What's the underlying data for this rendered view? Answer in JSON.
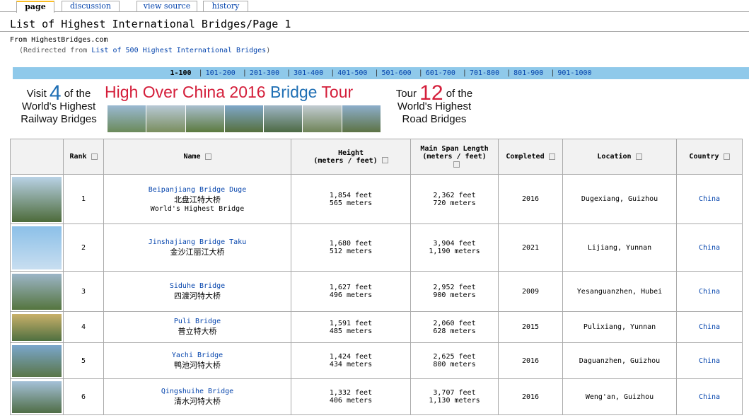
{
  "tabs": [
    {
      "label": "page",
      "active": true
    },
    {
      "label": "discussion",
      "active": false
    },
    {
      "label": "view source",
      "active": false
    },
    {
      "label": "history",
      "active": false
    }
  ],
  "title": "List of Highest International Bridges/Page 1",
  "from": "From HighestBridges.com",
  "redirect": {
    "prefix": "(Redirected from ",
    "link": "List of 500 Highest International Bridges",
    "suffix": ")"
  },
  "pager": [
    "1-100",
    "101-200",
    "201-300",
    "301-400",
    "401-500",
    "501-600",
    "601-700",
    "701-800",
    "801-900",
    "901-1000"
  ],
  "banner": {
    "left_visit": "Visit",
    "left_num": "4",
    "left_of": "of the",
    "left_line2": "World's Highest",
    "left_line3": "Railway Bridges",
    "mid_title_red": "High Over China 2016 ",
    "mid_title_blue": "Bridge",
    "mid_title_red2": " Tour",
    "right_tour": "Tour",
    "right_num": "12",
    "right_of": "of the",
    "right_line2": "World's Highest",
    "right_line3": "Road Bridges"
  },
  "table": {
    "headers": {
      "rank": "Rank",
      "name": "Name",
      "height1": "Height",
      "height2": "(meters / feet)",
      "span1": "Main Span Length",
      "span2": "(meters / feet)",
      "completed": "Completed",
      "location": "Location",
      "country": "Country"
    },
    "rows": [
      {
        "rank": "1",
        "name": "Beipanjiang Bridge Duge",
        "cn": "北盘江特大桥",
        "extra": "World's Highest Bridge",
        "h_ft": "1,854 feet",
        "h_m": "565 meters",
        "s_ft": "2,362 feet",
        "s_m": "720 meters",
        "completed": "2016",
        "location": "Dugexiang, Guizhou",
        "country": "China"
      },
      {
        "rank": "2",
        "name": "Jinshajiang Bridge Taku",
        "cn": "金沙江丽江大桥",
        "extra": "",
        "h_ft": "1,680 feet",
        "h_m": "512 meters",
        "s_ft": "3,904 feet",
        "s_m": "1,190 meters",
        "completed": "2021",
        "location": "Lijiang, Yunnan",
        "country": "China"
      },
      {
        "rank": "3",
        "name": "Siduhe Bridge",
        "cn": "四渡河特大桥",
        "extra": "",
        "h_ft": "1,627 feet",
        "h_m": "496 meters",
        "s_ft": "2,952 feet",
        "s_m": "900 meters",
        "completed": "2009",
        "location": "Yesanguanzhen, Hubei",
        "country": "China"
      },
      {
        "rank": "4",
        "name": "Puli Bridge",
        "cn": "普立特大桥",
        "extra": "",
        "h_ft": "1,591 feet",
        "h_m": "485 meters",
        "s_ft": "2,060 feet",
        "s_m": "628 meters",
        "completed": "2015",
        "location": "Pulixiang, Yunnan",
        "country": "China"
      },
      {
        "rank": "5",
        "name": "Yachi Bridge",
        "cn": "鸭池河特大桥",
        "extra": "",
        "h_ft": "1,424 feet",
        "h_m": "434 meters",
        "s_ft": "2,625 feet",
        "s_m": "800 meters",
        "completed": "2016",
        "location": "Daguanzhen, Guizhou",
        "country": "China"
      },
      {
        "rank": "6",
        "name": "Qingshuihe Bridge",
        "cn": "清水河特大桥",
        "extra": "",
        "h_ft": "1,332 feet",
        "h_m": "406 meters",
        "s_ft": "3,707 feet",
        "s_m": "1,130 meters",
        "completed": "2016",
        "location": "Weng'an, Guizhou",
        "country": "China"
      }
    ]
  },
  "colors": {
    "link": "#0645ad",
    "pager_bg": "#8fc9ea",
    "banner_red": "#d41e3a",
    "banner_blue": "#1f6fb4"
  }
}
